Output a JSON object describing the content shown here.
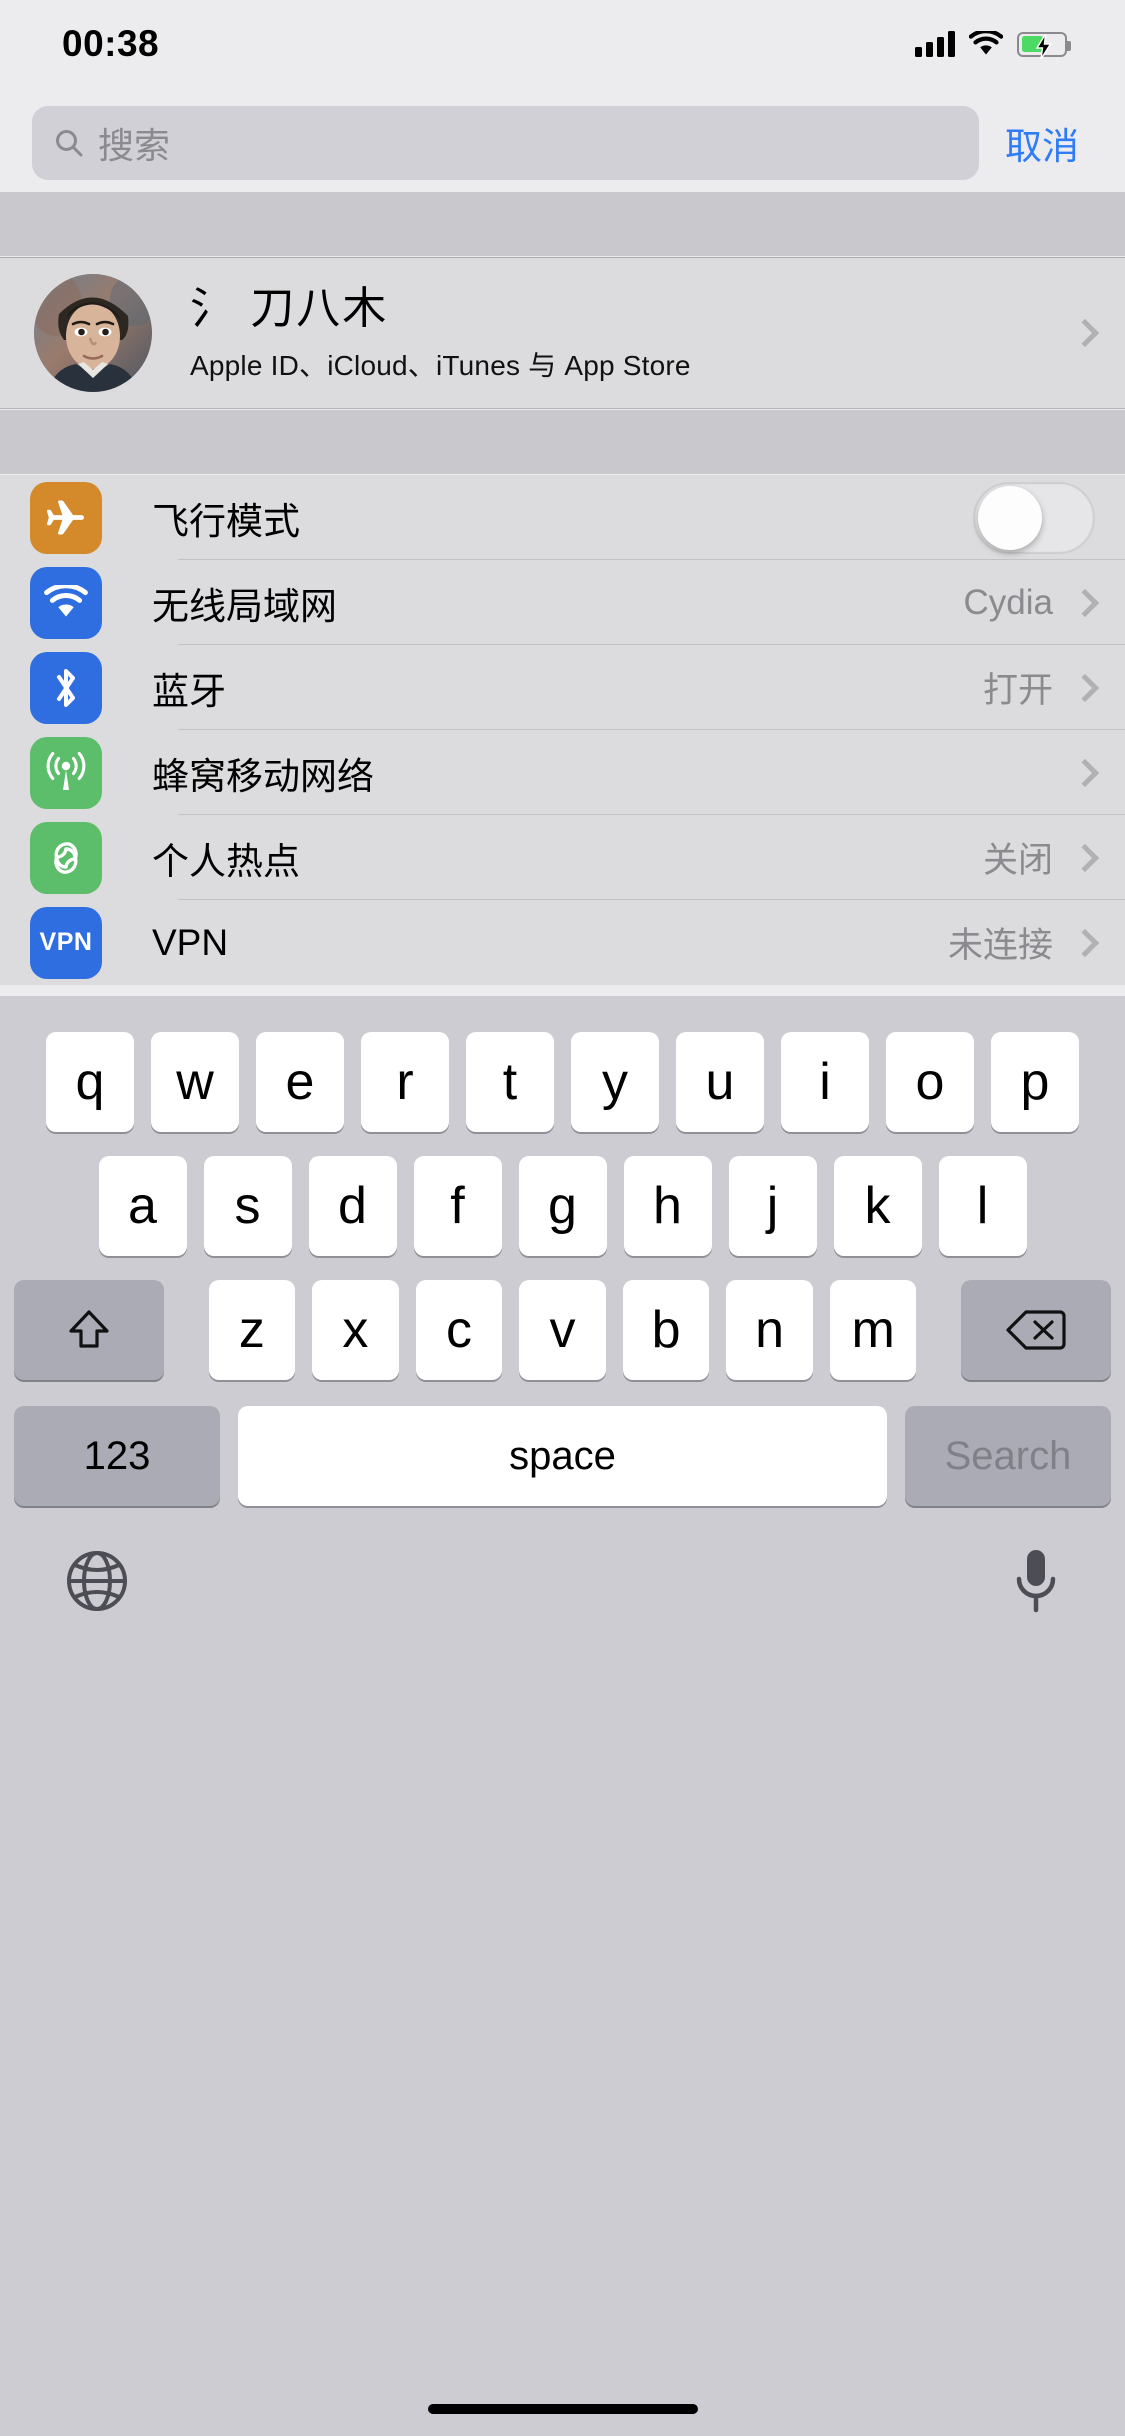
{
  "status_bar": {
    "time": "00:38",
    "signal_icon": "cellular-bars-icon",
    "wifi_icon": "wifi-icon",
    "battery_icon": "battery-charging-icon",
    "battery_color": "#4cd964"
  },
  "search": {
    "placeholder": "搜索",
    "value": "",
    "icon": "search-icon",
    "cancel_label": "取消",
    "cancel_color": "#2f7cf6"
  },
  "profile": {
    "name": "氵 刀八木",
    "subtitle": "Apple ID、iCloud、iTunes 与 App Store",
    "avatar": "user-photo-avatar",
    "chevron": "chevron-right-icon"
  },
  "settings_rows": [
    {
      "label": "飞行模式",
      "icon": "airplane-icon",
      "icon_color": "#d4892b",
      "control": "toggle",
      "toggle_on": false,
      "value": ""
    },
    {
      "label": "无线局域网",
      "icon": "wifi-icon",
      "icon_color": "#2f6ee0",
      "control": "chevron",
      "value": "Cydia"
    },
    {
      "label": "蓝牙",
      "icon": "bluetooth-icon",
      "icon_color": "#2f6ee0",
      "control": "chevron",
      "value": "打开"
    },
    {
      "label": "蜂窝移动网络",
      "icon": "cellular-antenna-icon",
      "icon_color": "#5cbd6a",
      "control": "chevron",
      "value": ""
    },
    {
      "label": "个人热点",
      "icon": "personal-hotspot-icon",
      "icon_color": "#5cbd6a",
      "control": "chevron",
      "value": "关闭"
    },
    {
      "label": "VPN",
      "icon": "vpn-icon",
      "icon_color": "#2f6ee0",
      "control": "chevron",
      "value": "未连接"
    }
  ],
  "keyboard": {
    "row1": [
      "q",
      "w",
      "e",
      "r",
      "t",
      "y",
      "u",
      "i",
      "o",
      "p"
    ],
    "row2": [
      "a",
      "s",
      "d",
      "f",
      "g",
      "h",
      "j",
      "k",
      "l"
    ],
    "row3": [
      "z",
      "x",
      "c",
      "v",
      "b",
      "n",
      "m"
    ],
    "shift_icon": "shift-up-arrow-icon",
    "backspace_icon": "backspace-delete-icon",
    "numbers_label": "123",
    "space_label": "space",
    "return_label": "Search",
    "globe_icon": "globe-language-icon",
    "mic_icon": "microphone-icon"
  }
}
